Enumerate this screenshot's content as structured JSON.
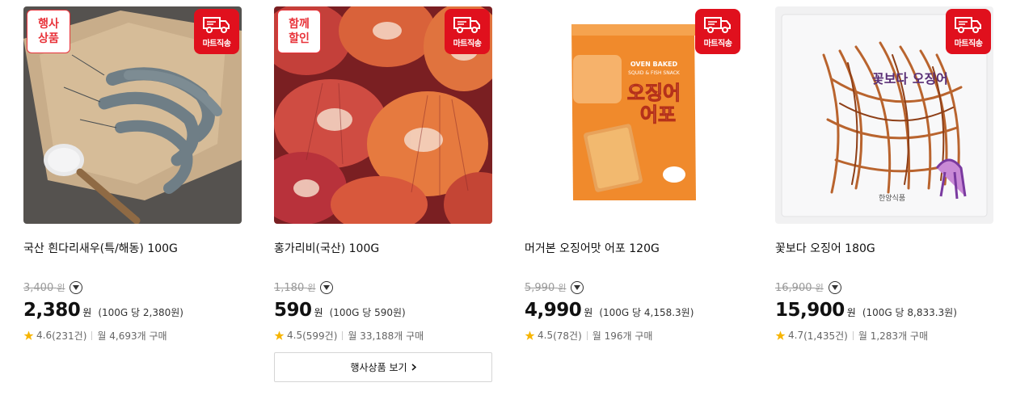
{
  "products": [
    {
      "name": "국산 흰다리새우(특/해동) 100G",
      "event_badge": "행사\n상품",
      "shipping_badge": "마트직송",
      "original_price": "3,400",
      "price": "2,380",
      "currency": "원",
      "unit_price": "(100G 당 2,380원)",
      "rating": "4.6",
      "reviews": "(231건)",
      "monthly": "월 4,693개 구매"
    },
    {
      "name": "홍가리비(국산) 100G",
      "event_badge": "함께\n할인",
      "shipping_badge": "마트직송",
      "original_price": "1,180",
      "price": "590",
      "currency": "원",
      "unit_price": "(100G 당 590원)",
      "rating": "4.5",
      "reviews": "(599건)",
      "monthly": "월 33,188개 구매"
    },
    {
      "name": "머거본 오징어맛 어포 120G",
      "shipping_badge": "마트직송",
      "original_price": "5,990",
      "price": "4,990",
      "currency": "원",
      "unit_price": "(100G 당 4,158.3원)",
      "rating": "4.5",
      "reviews": "(78건)",
      "monthly": "월 196개 구매"
    },
    {
      "name": "꽃보다 오징어 180G",
      "shipping_badge": "마트직송",
      "original_price": "16,900",
      "price": "15,900",
      "currency": "원",
      "unit_price": "(100G 당 8,833.3원)",
      "rating": "4.7",
      "reviews": "(1,435건)",
      "monthly": "월 1,283개 구매"
    }
  ],
  "orig_currency": "원",
  "more_button": "행사상품 보기",
  "package_texts": {
    "p3_brand_top": "OVEN BAKED",
    "p3_brand_sub": "SQUID & FISH SNACK",
    "p3_title_1": "오징어",
    "p3_title_2": "어포",
    "p4_title": "꽃보다 오징어",
    "p4_maker": "한양식품"
  },
  "colors": {
    "accent_red": "#e0101d",
    "badge_red": "#e8333a",
    "star": "#f7b500"
  }
}
